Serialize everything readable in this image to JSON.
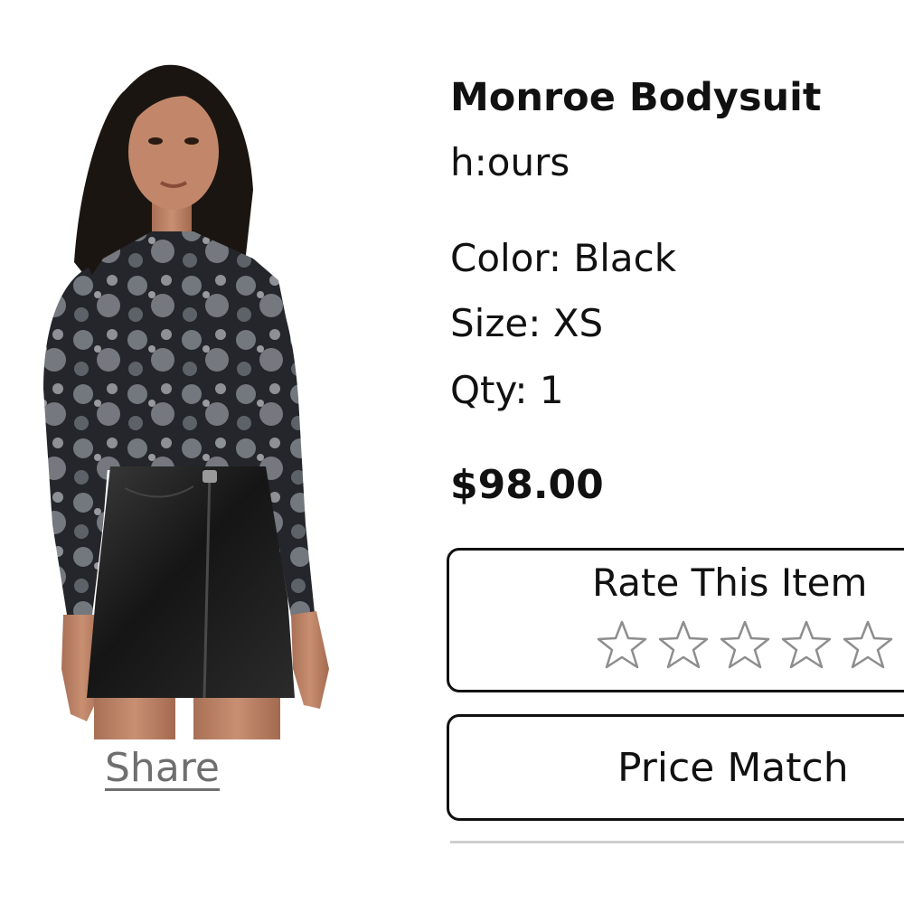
{
  "product": {
    "name": "Monroe Bodysuit",
    "brand": "h:ours",
    "color": "Color: Black",
    "size": "Size: XS",
    "qty": "Qty: 1",
    "price": "$98.00"
  },
  "share_label": "Share",
  "rating": {
    "title": "Rate This Item",
    "max_stars": 5,
    "current": 0
  },
  "price_match_label": "Price Match"
}
